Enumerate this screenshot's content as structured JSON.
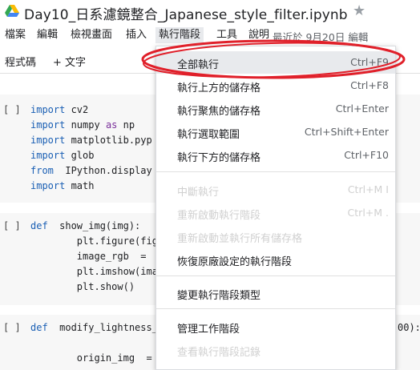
{
  "title": {
    "notebook_name": "Day10_日系濾鏡整合_Japanese_style_filter.ipynb",
    "logo_icon": "colab-drive-logo",
    "star_icon": "star-icon"
  },
  "menubar": {
    "items": [
      "檔案",
      "編輯",
      "檢視畫面",
      "插入",
      "執行階段",
      "工具",
      "說明"
    ],
    "last_edit_prefix": "最近於 ",
    "last_edit_date": "9月20日",
    "last_edit_suffix": " 編輯"
  },
  "toolbar": {
    "code_label": "程式碼",
    "text_label": "+ 文字"
  },
  "cells": [
    {
      "run": "[ ]",
      "lines": [
        {
          "kw": "import",
          "rest": " cv2"
        },
        {
          "kw": "import",
          "rest": " numpy ",
          "kw2": "as",
          "rest2": " np"
        },
        {
          "kw": "import",
          "rest": " matplotlib.pyp"
        },
        {
          "kw": "import",
          "rest": " glob"
        },
        {
          "kw": "from",
          "rest": "  IPython.display"
        },
        {
          "kw": "import",
          "rest": " math"
        }
      ]
    },
    {
      "run": "[ ]",
      "lines": [
        {
          "kw": "def",
          "rest": "  show_img(img):"
        },
        {
          "kw": "",
          "rest": "        plt.figure(fig"
        },
        {
          "kw": "",
          "rest": "        image_rgb  ="
        },
        {
          "kw": "",
          "rest": "        plt.imshow(ima"
        },
        {
          "kw": "",
          "rest": "        plt.show()"
        }
      ]
    },
    {
      "run": "[ ]",
      "lines": [
        {
          "kw": "def",
          "rest": "  modify_lightness_"
        },
        {
          "kw": "",
          "rest": ""
        },
        {
          "kw": "",
          "rest": "        origin_img  ="
        }
      ],
      "tail": "00):"
    }
  ],
  "dropdown": {
    "items": [
      {
        "label": "全部執行",
        "shortcut": "Ctrl+F9",
        "disabled": false,
        "highlight": true
      },
      {
        "label": "執行上方的儲存格",
        "shortcut": "Ctrl+F8",
        "disabled": false
      },
      {
        "label": "執行聚焦的儲存格",
        "shortcut": "Ctrl+Enter",
        "disabled": false
      },
      {
        "label": "執行選取範圍",
        "shortcut": "Ctrl+Shift+Enter",
        "disabled": false
      },
      {
        "label": "執行下方的儲存格",
        "shortcut": "Ctrl+F10",
        "disabled": false
      },
      {
        "label": "中斷執行",
        "shortcut": "Ctrl+M I",
        "disabled": true
      },
      {
        "label": "重新啟動執行階段",
        "shortcut": "Ctrl+M .",
        "disabled": true
      },
      {
        "label": "重新啟動並執行所有儲存格",
        "shortcut": "",
        "disabled": true
      },
      {
        "label": "恢復原廠設定的執行階段",
        "shortcut": "",
        "disabled": false
      },
      {
        "label": "變更執行階段類型",
        "shortcut": "",
        "disabled": false
      },
      {
        "label": "管理工作階段",
        "shortcut": "",
        "disabled": false
      },
      {
        "label": "查看執行階段記錄",
        "shortcut": "",
        "disabled": true
      }
    ]
  },
  "colors": {
    "annotation": "#e0202a",
    "keyword": "#1a5fb4",
    "menu_active_bg": "#e8eaed"
  }
}
